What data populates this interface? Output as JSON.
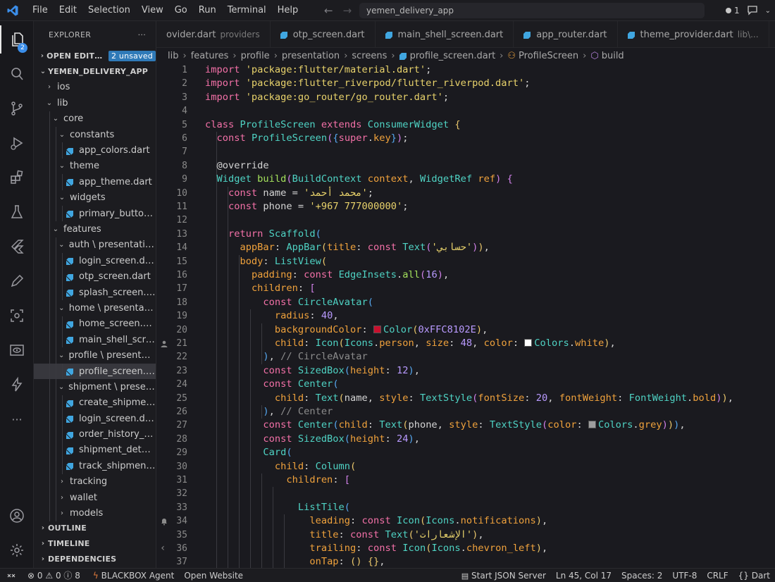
{
  "colors": {
    "accent": "#3b8eea",
    "background": "#1a1a1f",
    "keyword": "#f471a8",
    "string": "#e8d26b",
    "class": "#4fd3c4",
    "function": "#a4e15c",
    "number": "#b99aff",
    "property": "#f0a23c",
    "comment": "#8c8c8c",
    "swatch_color": "#ffc8102e",
    "swatch_white": "#ffffff",
    "swatch_grey": "#9e9e9e"
  },
  "titlebar": {
    "menu": [
      "File",
      "Edit",
      "Selection",
      "View",
      "Go",
      "Run",
      "Terminal",
      "Help"
    ],
    "command_center": "yemen_delivery_app",
    "notifications_count": "1"
  },
  "activity_bar": {
    "explorer_badge": "2",
    "icons": [
      "files-icon",
      "search-icon",
      "source-control-icon",
      "run-debug-icon",
      "extensions-icon",
      "testing-icon",
      "flutter-icon",
      "edit-icon",
      "scan-icon",
      "preview-icon",
      "lightning-icon",
      "more-icon",
      "account-icon",
      "settings-gear-icon"
    ]
  },
  "sidebar": {
    "title": "EXPLORER",
    "more": "···",
    "open_editors": "OPEN EDITORS",
    "unsaved_badge": "2 unsaved",
    "project": "YEMEN_DELIVERY_APP",
    "tree": [
      {
        "label": "ios",
        "chev": "›"
      },
      {
        "label": "lib",
        "chev": "⌄"
      },
      {
        "label": "core",
        "chev": "⌄"
      },
      {
        "label": "constants",
        "chev": "⌄"
      },
      {
        "label": "app_colors.dart",
        "file": true
      },
      {
        "label": "theme",
        "chev": "⌄"
      },
      {
        "label": "app_theme.dart",
        "file": true
      },
      {
        "label": "widgets",
        "chev": "⌄"
      },
      {
        "label": "primary_button.dart",
        "file": true
      },
      {
        "label": "features",
        "chev": "⌄"
      },
      {
        "label": "auth \\ presentation...",
        "chev": "⌄"
      },
      {
        "label": "login_screen.dart",
        "file": true
      },
      {
        "label": "otp_screen.dart",
        "file": true
      },
      {
        "label": "splash_screen.dart",
        "file": true
      },
      {
        "label": "home \\ presentatio...",
        "chev": "⌄"
      },
      {
        "label": "home_screen.dart",
        "file": true
      },
      {
        "label": "main_shell_screen....",
        "file": true
      },
      {
        "label": "profile \\ presentatio...",
        "chev": "⌄"
      },
      {
        "label": "profile_screen.dart",
        "file": true,
        "selected": true
      },
      {
        "label": "shipment \\ presenta...",
        "chev": "⌄"
      },
      {
        "label": "create_shipment_s...",
        "file": true
      },
      {
        "label": "login_screen.dart",
        "file": true
      },
      {
        "label": "order_history_scre...",
        "file": true
      },
      {
        "label": "shipment_details_...",
        "file": true
      },
      {
        "label": "track_shipment_sc...",
        "file": true
      },
      {
        "label": "tracking",
        "chev": "›"
      },
      {
        "label": "wallet",
        "chev": "›"
      },
      {
        "label": "models",
        "chev": "›"
      }
    ],
    "outline": "OUTLINE",
    "timeline": "TIMELINE",
    "dependencies": "DEPENDENCIES"
  },
  "tabs": [
    {
      "label": "ovider.dart",
      "hint": "providers"
    },
    {
      "label": "otp_screen.dart",
      "hint": ""
    },
    {
      "label": "main_shell_screen.dart",
      "hint": ""
    },
    {
      "label": "app_router.dart",
      "hint": ""
    },
    {
      "label": "theme_provider.dart",
      "hint": "lib\\..."
    }
  ],
  "breadcrumbs": [
    "lib",
    "features",
    "profile",
    "presentation",
    "screens",
    "profile_screen.dart",
    "ProfileScreen",
    "build"
  ],
  "status_bar": {
    "errors": "0",
    "warnings": "0",
    "info": "8",
    "blackbox": "BLACKBOX Agent",
    "open_website": "Open Website",
    "json_server": "Start JSON Server",
    "position": "Ln 45, Col 17",
    "spaces": "Spaces: 2",
    "encoding": "UTF-8",
    "eol": "CRLF",
    "language": "Dart",
    "braces": "{}"
  },
  "code_lines": [
    [
      [
        "kw",
        "import "
      ],
      [
        "str",
        "'package:flutter/material.dart'"
      ],
      [
        "dec",
        ";"
      ]
    ],
    [
      [
        "kw",
        "import "
      ],
      [
        "str",
        "'package:flutter_riverpod/flutter_riverpod.dart'"
      ],
      [
        "dec",
        ";"
      ]
    ],
    [
      [
        "kw",
        "import "
      ],
      [
        "str",
        "'package:go_router/go_router.dart'"
      ],
      [
        "dec",
        ";"
      ]
    ],
    [],
    [
      [
        "kw",
        "class "
      ],
      [
        "cls",
        "ProfileScreen "
      ],
      [
        "kw",
        "extends "
      ],
      [
        "cls",
        "ConsumerWidget "
      ],
      [
        "br1",
        "{"
      ]
    ],
    [
      [
        "dec",
        "  "
      ],
      [
        "kw",
        "const "
      ],
      [
        "cls",
        "ProfileScreen"
      ],
      [
        "br2",
        "("
      ],
      [
        "br3",
        "{"
      ],
      [
        "kw",
        "super"
      ],
      [
        "dec",
        "."
      ],
      [
        "prop",
        "key"
      ],
      [
        "br3",
        "}"
      ],
      [
        "br2",
        ")"
      ],
      [
        "dec",
        ";"
      ]
    ],
    [],
    [
      [
        "dec",
        "  @override"
      ]
    ],
    [
      [
        "dec",
        "  "
      ],
      [
        "cls",
        "Widget "
      ],
      [
        "fn",
        "build"
      ],
      [
        "br2",
        "("
      ],
      [
        "cls",
        "BuildContext "
      ],
      [
        "prop",
        "context"
      ],
      [
        "dec",
        ", "
      ],
      [
        "cls",
        "WidgetRef "
      ],
      [
        "prop",
        "ref"
      ],
      [
        "br2",
        ")"
      ],
      [
        "dec",
        " "
      ],
      [
        "br2",
        "{"
      ]
    ],
    [
      [
        "dec",
        "    "
      ],
      [
        "kw",
        "const "
      ],
      [
        "dec",
        "name = "
      ],
      [
        "str",
        "'محمد أحمد'"
      ],
      [
        "dec",
        ";"
      ]
    ],
    [
      [
        "dec",
        "    "
      ],
      [
        "kw",
        "const "
      ],
      [
        "dec",
        "phone = "
      ],
      [
        "str",
        "'+967 777000000'"
      ],
      [
        "dec",
        ";"
      ]
    ],
    [],
    [
      [
        "dec",
        "    "
      ],
      [
        "kw",
        "return "
      ],
      [
        "cls",
        "Scaffold"
      ],
      [
        "br3",
        "("
      ]
    ],
    [
      [
        "dec",
        "      "
      ],
      [
        "prop",
        "appBar"
      ],
      [
        "dec",
        ": "
      ],
      [
        "cls",
        "AppBar"
      ],
      [
        "br1",
        "("
      ],
      [
        "prop",
        "title"
      ],
      [
        "dec",
        ": "
      ],
      [
        "kw",
        "const "
      ],
      [
        "cls",
        "Text"
      ],
      [
        "br2",
        "("
      ],
      [
        "str",
        "'حسابي'"
      ],
      [
        "br2",
        ")"
      ],
      [
        "br1",
        ")"
      ],
      [
        "dec",
        ","
      ]
    ],
    [
      [
        "dec",
        "      "
      ],
      [
        "prop",
        "body"
      ],
      [
        "dec",
        ": "
      ],
      [
        "cls",
        "ListView"
      ],
      [
        "br1",
        "("
      ]
    ],
    [
      [
        "dec",
        "        "
      ],
      [
        "prop",
        "padding"
      ],
      [
        "dec",
        ": "
      ],
      [
        "kw",
        "const "
      ],
      [
        "cls",
        "EdgeInsets"
      ],
      [
        "dec",
        "."
      ],
      [
        "fn",
        "all"
      ],
      [
        "br2",
        "("
      ],
      [
        "num",
        "16"
      ],
      [
        "br2",
        ")"
      ],
      [
        "dec",
        ","
      ]
    ],
    [
      [
        "dec",
        "        "
      ],
      [
        "prop",
        "children"
      ],
      [
        "dec",
        ": "
      ],
      [
        "br2",
        "["
      ]
    ],
    [
      [
        "dec",
        "          "
      ],
      [
        "kw",
        "const "
      ],
      [
        "cls",
        "CircleAvatar"
      ],
      [
        "br3",
        "("
      ]
    ],
    [
      [
        "dec",
        "            "
      ],
      [
        "prop",
        "radius"
      ],
      [
        "dec",
        ": "
      ],
      [
        "num",
        "40"
      ],
      [
        "dec",
        ","
      ]
    ],
    [
      [
        "dec",
        "            "
      ],
      [
        "prop",
        "backgroundColor"
      ],
      [
        "dec",
        ": "
      ],
      [
        "swatch",
        "#c8102e"
      ],
      [
        "cls",
        "Color"
      ],
      [
        "br1",
        "("
      ],
      [
        "num",
        "0xFFC8102E"
      ],
      [
        "br1",
        ")"
      ],
      [
        "dec",
        ","
      ]
    ],
    [
      [
        "dec",
        "            "
      ],
      [
        "prop",
        "child"
      ],
      [
        "dec",
        ": "
      ],
      [
        "cls",
        "Icon"
      ],
      [
        "br1",
        "("
      ],
      [
        "cls",
        "Icons"
      ],
      [
        "dec",
        "."
      ],
      [
        "prop",
        "person"
      ],
      [
        "dec",
        ", "
      ],
      [
        "prop",
        "size"
      ],
      [
        "dec",
        ": "
      ],
      [
        "num",
        "48"
      ],
      [
        "dec",
        ", "
      ],
      [
        "prop",
        "color"
      ],
      [
        "dec",
        ": "
      ],
      [
        "swatch",
        "#ffffff"
      ],
      [
        "cls",
        "Colors"
      ],
      [
        "dec",
        "."
      ],
      [
        "prop",
        "white"
      ],
      [
        "br1",
        ")"
      ],
      [
        "dec",
        ","
      ]
    ],
    [
      [
        "dec",
        "          "
      ],
      [
        "br3",
        ")"
      ],
      [
        "dec",
        ", "
      ],
      [
        "cm",
        "// CircleAvatar"
      ]
    ],
    [
      [
        "dec",
        "          "
      ],
      [
        "kw",
        "const "
      ],
      [
        "cls",
        "SizedBox"
      ],
      [
        "br3",
        "("
      ],
      [
        "prop",
        "height"
      ],
      [
        "dec",
        ": "
      ],
      [
        "num",
        "12"
      ],
      [
        "br3",
        ")"
      ],
      [
        "dec",
        ","
      ]
    ],
    [
      [
        "dec",
        "          "
      ],
      [
        "kw",
        "const "
      ],
      [
        "cls",
        "Center"
      ],
      [
        "br3",
        "("
      ]
    ],
    [
      [
        "dec",
        "            "
      ],
      [
        "prop",
        "child"
      ],
      [
        "dec",
        ": "
      ],
      [
        "cls",
        "Text"
      ],
      [
        "br1",
        "("
      ],
      [
        "dec",
        "name, "
      ],
      [
        "prop",
        "style"
      ],
      [
        "dec",
        ": "
      ],
      [
        "cls",
        "TextStyle"
      ],
      [
        "br2",
        "("
      ],
      [
        "prop",
        "fontSize"
      ],
      [
        "dec",
        ": "
      ],
      [
        "num",
        "20"
      ],
      [
        "dec",
        ", "
      ],
      [
        "prop",
        "fontWeight"
      ],
      [
        "dec",
        ": "
      ],
      [
        "cls",
        "FontWeight"
      ],
      [
        "dec",
        "."
      ],
      [
        "prop",
        "bold"
      ],
      [
        "br2",
        ")"
      ],
      [
        "br1",
        ")"
      ],
      [
        "dec",
        ","
      ]
    ],
    [
      [
        "dec",
        "          "
      ],
      [
        "br3",
        ")"
      ],
      [
        "dec",
        ", "
      ],
      [
        "cm",
        "// Center"
      ]
    ],
    [
      [
        "dec",
        "          "
      ],
      [
        "kw",
        "const "
      ],
      [
        "cls",
        "Center"
      ],
      [
        "br3",
        "("
      ],
      [
        "prop",
        "child"
      ],
      [
        "dec",
        ": "
      ],
      [
        "cls",
        "Text"
      ],
      [
        "br1",
        "("
      ],
      [
        "dec",
        "phone, "
      ],
      [
        "prop",
        "style"
      ],
      [
        "dec",
        ": "
      ],
      [
        "cls",
        "TextStyle"
      ],
      [
        "br2",
        "("
      ],
      [
        "prop",
        "color"
      ],
      [
        "dec",
        ": "
      ],
      [
        "swatch",
        "#9e9e9e"
      ],
      [
        "cls",
        "Colors"
      ],
      [
        "dec",
        "."
      ],
      [
        "prop",
        "grey"
      ],
      [
        "br2",
        ")"
      ],
      [
        "br1",
        ")"
      ],
      [
        "br3",
        ")"
      ],
      [
        "dec",
        ","
      ]
    ],
    [
      [
        "dec",
        "          "
      ],
      [
        "kw",
        "const "
      ],
      [
        "cls",
        "SizedBox"
      ],
      [
        "br3",
        "("
      ],
      [
        "prop",
        "height"
      ],
      [
        "dec",
        ": "
      ],
      [
        "num",
        "24"
      ],
      [
        "br3",
        ")"
      ],
      [
        "dec",
        ","
      ]
    ],
    [
      [
        "dec",
        "          "
      ],
      [
        "cls",
        "Card"
      ],
      [
        "br3",
        "("
      ]
    ],
    [
      [
        "dec",
        "            "
      ],
      [
        "prop",
        "child"
      ],
      [
        "dec",
        ": "
      ],
      [
        "cls",
        "Column"
      ],
      [
        "br1",
        "("
      ]
    ],
    [
      [
        "dec",
        "              "
      ],
      [
        "prop",
        "children"
      ],
      [
        "dec",
        ": "
      ],
      [
        "br2",
        "["
      ]
    ],
    [],
    [
      [
        "dec",
        "                "
      ],
      [
        "cls",
        "ListTile"
      ],
      [
        "br3",
        "("
      ]
    ],
    [
      [
        "dec",
        "                  "
      ],
      [
        "prop",
        "leading"
      ],
      [
        "dec",
        ": "
      ],
      [
        "kw",
        "const "
      ],
      [
        "cls",
        "Icon"
      ],
      [
        "br1",
        "("
      ],
      [
        "cls",
        "Icons"
      ],
      [
        "dec",
        "."
      ],
      [
        "prop",
        "notifications"
      ],
      [
        "br1",
        ")"
      ],
      [
        "dec",
        ","
      ]
    ],
    [
      [
        "dec",
        "                  "
      ],
      [
        "prop",
        "title"
      ],
      [
        "dec",
        ": "
      ],
      [
        "kw",
        "const "
      ],
      [
        "cls",
        "Text"
      ],
      [
        "br1",
        "("
      ],
      [
        "str",
        "'الإشعارات'"
      ],
      [
        "br1",
        ")"
      ],
      [
        "dec",
        ","
      ]
    ],
    [
      [
        "dec",
        "                  "
      ],
      [
        "prop",
        "trailing"
      ],
      [
        "dec",
        ": "
      ],
      [
        "kw",
        "const "
      ],
      [
        "cls",
        "Icon"
      ],
      [
        "br1",
        "("
      ],
      [
        "cls",
        "Icons"
      ],
      [
        "dec",
        "."
      ],
      [
        "prop",
        "chevron_left"
      ],
      [
        "br1",
        ")"
      ],
      [
        "dec",
        ","
      ]
    ],
    [
      [
        "dec",
        "                  "
      ],
      [
        "prop",
        "onTap"
      ],
      [
        "dec",
        ": "
      ],
      [
        "br1",
        "()"
      ],
      [
        "dec",
        " "
      ],
      [
        "br1",
        "{}"
      ],
      [
        "dec",
        ","
      ]
    ]
  ]
}
